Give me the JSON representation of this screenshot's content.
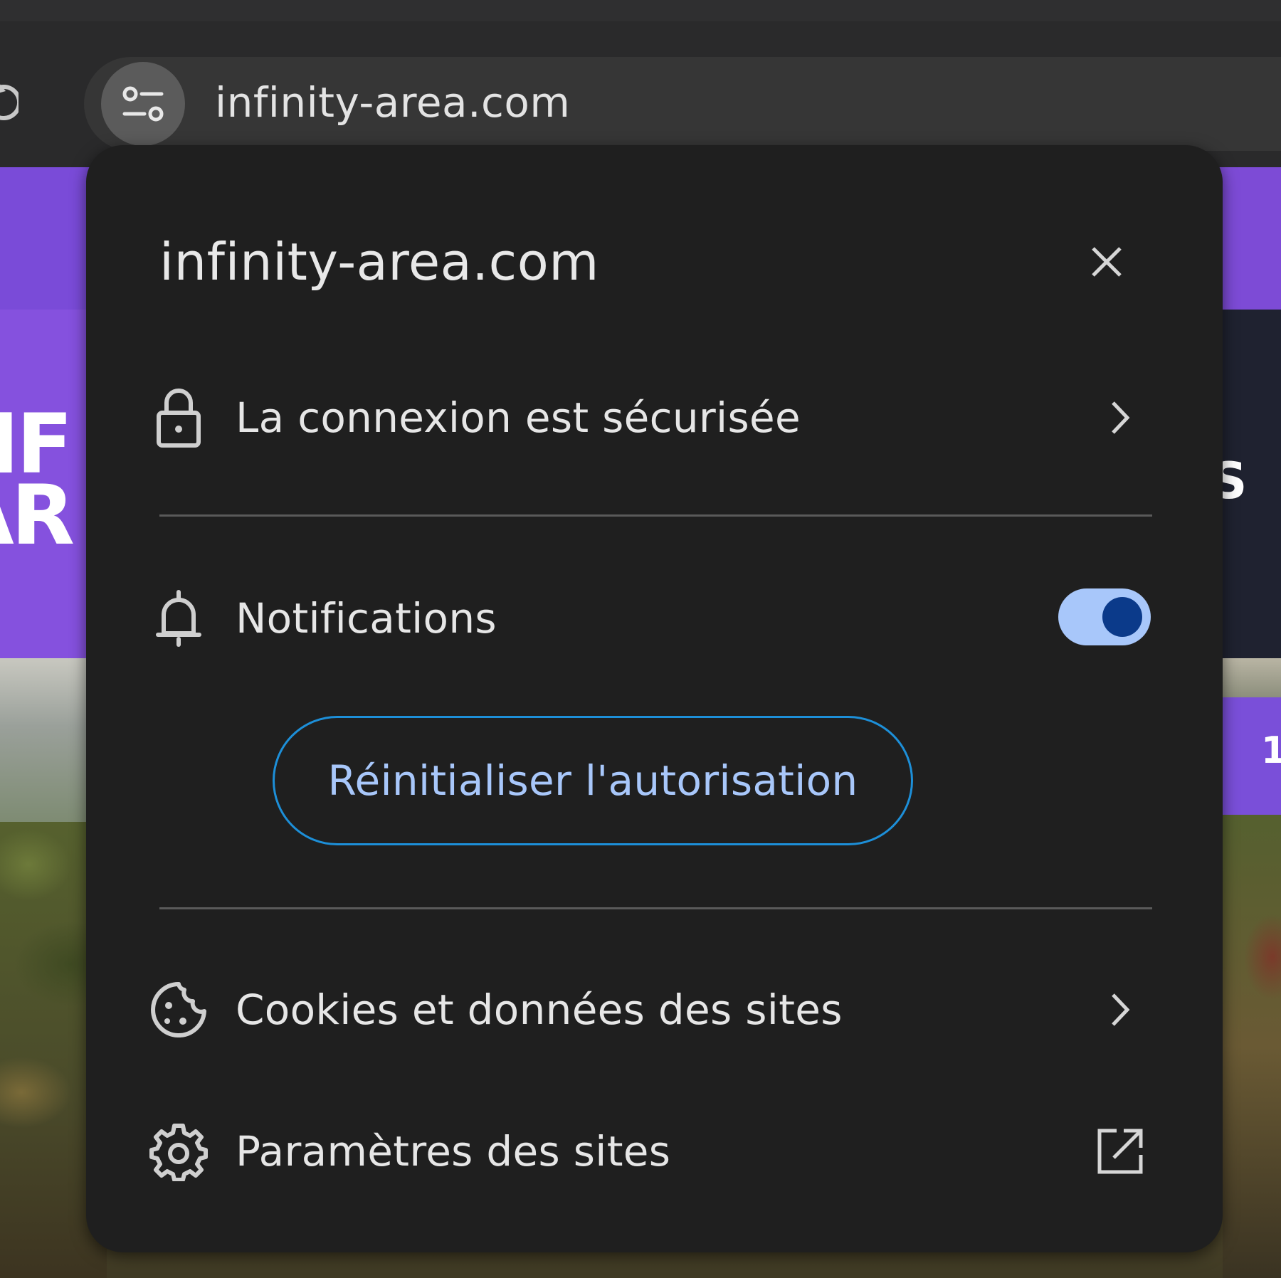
{
  "omnibox": {
    "url": "infinity-area.com",
    "site_info_icon": "tune-icon"
  },
  "website": {
    "logo_partial": "NF\nAR",
    "right_partial_text": "S",
    "right_badge_partial": "1",
    "brand_color": "#7d4bd6"
  },
  "popup": {
    "title": "infinity-area.com",
    "close_icon": "close-icon",
    "connection": {
      "icon": "lock-icon",
      "label": "La connexion est sécurisée"
    },
    "notifications": {
      "icon": "bell-icon",
      "label": "Notifications",
      "toggle_on": true,
      "reset_button": "Réinitialiser l'autorisation"
    },
    "cookies": {
      "icon": "cookie-icon",
      "label": "Cookies et données des sites"
    },
    "site_settings": {
      "icon": "gear-icon",
      "label": "Paramètres des sites",
      "trail_icon": "open-in-new-icon"
    }
  },
  "colors": {
    "popup_bg": "#1f1f1f",
    "toggle_track": "#a8c7fa",
    "toggle_knob": "#0b3a8a",
    "button_border": "#1d8fd8",
    "button_text": "#a8c7fa"
  }
}
